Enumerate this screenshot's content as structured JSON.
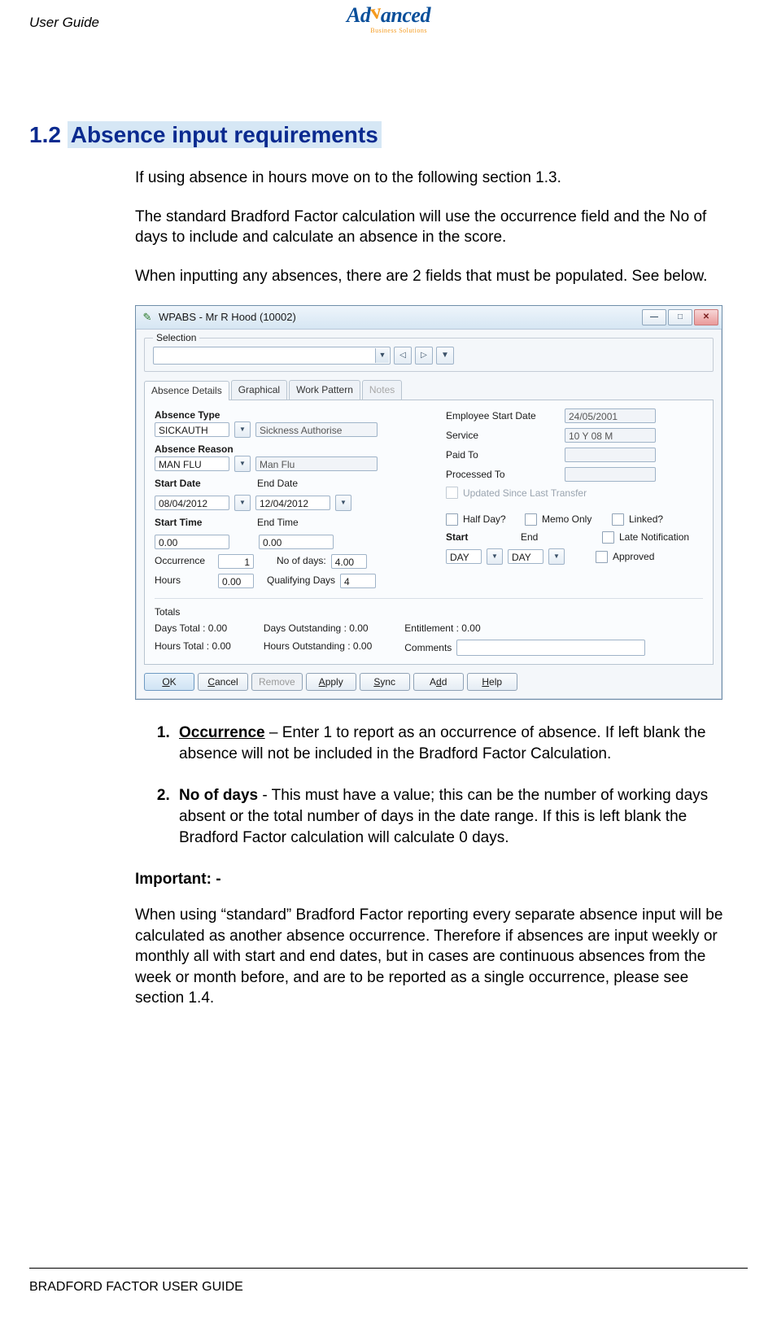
{
  "doc_header": "User Guide",
  "brand": {
    "name": "Advanced",
    "sub": "Business Solutions"
  },
  "section": {
    "number": "1.2",
    "title": "Absence input requirements"
  },
  "paragraphs": {
    "p1": "If using absence in hours move on to the following section 1.3.",
    "p2": "The standard Bradford Factor calculation will use the occurrence field and the No of days to include and calculate an absence in the score.",
    "p3": "When inputting any absences, there are 2 fields that must be populated. See below."
  },
  "window": {
    "title": "WPABS - Mr R Hood (10002)",
    "selection_label": "Selection",
    "tabs": [
      "Absence Details",
      "Graphical",
      "Work Pattern",
      "Notes"
    ],
    "labels": {
      "absence_type": "Absence Type",
      "absence_reason": "Absence Reason",
      "start_date": "Start Date",
      "end_date": "End Date",
      "start_time": "Start Time",
      "end_time": "End Time",
      "occurrence": "Occurrence",
      "no_of_days": "No of days:",
      "hours": "Hours",
      "qualifying_days": "Qualifying Days",
      "employee_start_date": "Employee Start Date",
      "service": "Service",
      "paid_to": "Paid To",
      "processed_to": "Processed To",
      "updated_since": "Updated Since Last Transfer",
      "half_day": "Half Day?",
      "memo_only": "Memo Only",
      "linked": "Linked?",
      "start": "Start",
      "end": "End",
      "late_notification": "Late Notification",
      "approved": "Approved",
      "totals": "Totals",
      "days_total": "Days Total : 0.00",
      "hours_total": "Hours Total : 0.00",
      "days_outstanding": "Days Outstanding : 0.00",
      "hours_outstanding": "Hours Outstanding : 0.00",
      "entitlement": "Entitlement : 0.00",
      "comments": "Comments"
    },
    "values": {
      "absence_type_code": "SICKAUTH",
      "absence_type_desc": "Sickness Authorise",
      "absence_reason_code": "MAN FLU",
      "absence_reason_desc": "Man Flu",
      "start_date": "08/04/2012",
      "end_date": "12/04/2012",
      "start_time": "0.00",
      "end_time": "0.00",
      "occurrence": "1",
      "no_of_days": "4.00",
      "hours": "0.00",
      "qualifying_days": "4",
      "employee_start_date": "24/05/2001",
      "service": "10 Y 08 M",
      "start_sel": "DAY",
      "end_sel": "DAY"
    },
    "buttons": {
      "ok": "OK",
      "cancel": "Cancel",
      "remove": "Remove",
      "apply": "Apply",
      "sync": "Sync",
      "add": "Add",
      "help": "Help"
    }
  },
  "list": {
    "item1_lead": "Occurrence",
    "item1_rest": " – Enter 1 to report as an occurrence of absence. If left blank the absence will not be included in the Bradford Factor Calculation.",
    "item2_lead": "No of days",
    "item2_rest": " - This must have a value; this can be the number of working days absent or the total number of days in the date range. If this is left blank the Bradford Factor calculation will calculate 0 days."
  },
  "important_label": "Important: -",
  "important_text": "When using “standard” Bradford Factor reporting every separate absence input will be calculated as another absence occurrence. Therefore if absences are input weekly or monthly all with start and end dates, but in cases are continuous absences from the week or month before, and are to be reported as a single occurrence, please see section 1.4.",
  "footer": "BRADFORD FACTOR USER GUIDE"
}
